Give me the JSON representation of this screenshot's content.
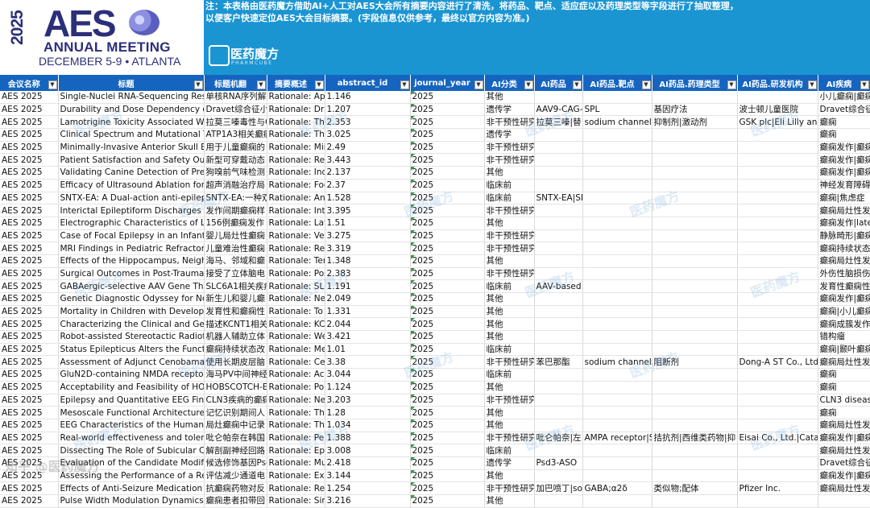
{
  "logo": {
    "year": "2025",
    "word": "AES",
    "subtitle": "ANNUAL MEETING",
    "dates": "DECEMBER 5-9 • ATLANTA"
  },
  "notice": {
    "line1": "注：本表格由医药魔方借助AI+人工对AES大会所有摘要内容进行了清洗，将药品、靶点、适应症以及药理类型等字段进行了抽取整理，",
    "line2": "以便客户快速定位AES大会目标摘要。(字段信息仅供参考，最终以官方内容为准。)"
  },
  "brand": {
    "name": "医药魔方",
    "sub": "PHARMCUBE"
  },
  "watermark": "医药魔方",
  "corner_watermark": "知乎 @医药魔方",
  "columns": [
    "会议名称",
    "标题",
    "标题机翻",
    "摘要概述",
    "abstract_id",
    "journal_year",
    "AI分类",
    "AI药品",
    "AI药品.靶点",
    "AI药品.药理类型",
    "AI药品.研发机构",
    "AI疾病"
  ],
  "rows": [
    [
      "AES 2025",
      "Single-Nuclei RNA-Sequencing Res",
      "单核RNA序列解",
      "Rationale: App",
      "1.146",
      "2025",
      "其他",
      "",
      "",
      "",
      "",
      "小儿癫痫|癫痫"
    ],
    [
      "AES 2025",
      "Durability and Dose Dependency of",
      "Dravet综合征小",
      "Rationale: Dra",
      "1.207",
      "2025",
      "遗传学",
      "AAV9-CAG-",
      "SPL",
      "基因疗法",
      "波士顿儿童医院",
      "Dravet综合征"
    ],
    [
      "AES 2025",
      "Lamotrigine Toxicity Associated Wi",
      "拉莫三嗪毒性与C",
      "Rationale: The",
      "2.353",
      "2025",
      "非干预性研究",
      "拉莫三嗪|替",
      "sodium channel|C",
      "抑制剂|激动剂",
      "GSK plc|Eli Lilly and",
      "癫痫"
    ],
    [
      "AES 2025",
      "Clinical Spectrum and Mutational T",
      "ATP1A3相关癫痫",
      "Rationale: The",
      "3.025",
      "2025",
      "遗传学",
      "",
      "",
      "",
      "",
      "癫痫"
    ],
    [
      "AES 2025",
      "Minimally-Invasive Anterior Skull Ba",
      "用于儿童癫痫的",
      "Rationale: Min",
      "2.49",
      "2025",
      "非干预性研究",
      "",
      "",
      "",
      "",
      "癫痫发作|癫痫"
    ],
    [
      "AES 2025",
      "Patient Satisfaction and Safety Outc",
      "新型可穿戴动态",
      "Rationale: Rem",
      "3.443",
      "2025",
      "非干预性研究",
      "",
      "",
      "",
      "",
      "癫痫发作|癫痫"
    ],
    [
      "AES 2025",
      "Validating  Canine Detection of Pre",
      "狗嗅前气味检测",
      "Rationale: Ind",
      "2.137",
      "2025",
      "其他",
      "",
      "",
      "",
      "",
      "癫痫发作|癫痫"
    ],
    [
      "AES 2025",
      "Efficacy of Ultrasound Ablation for",
      "超声消融治疗局",
      "Rationale: Foc",
      "2.37",
      "2025",
      "临床前",
      "",
      "",
      "",
      "",
      "神经发育障碍"
    ],
    [
      "AES 2025",
      "SNTX-EA: A Dual-action anti-epilep",
      "SNTX-EA:一种双",
      "Rationale: Ant",
      "1.528",
      "2025",
      "临床前",
      "SNTX-EA|SN",
      "",
      "",
      "",
      "癫痫|焦虑症"
    ],
    [
      "AES 2025",
      "Interictal Epileptiform Discharges a",
      "发作间期癫痫样",
      "Rationale: Inte",
      "3.395",
      "2025",
      "非干预性研究",
      "",
      "",
      "",
      "",
      "癫痫局灶性发作"
    ],
    [
      "AES 2025",
      "Electrographic Characteristics of La",
      "156例癫痫发作",
      "Rationale: Late",
      "1.51",
      "2025",
      "其他",
      "",
      "",
      "",
      "",
      "癫痫发作|late"
    ],
    [
      "AES 2025",
      "Case of Focal Epilepsy in an Infant w",
      "婴儿局灶性癫痫",
      "Rationale: Vei",
      "3.275",
      "2025",
      "非干预性研究",
      "",
      "",
      "",
      "",
      "静脉畸形|癫痫"
    ],
    [
      "AES 2025",
      "MRI Findings in Pediatric Refractory",
      "儿童难治性癫痫",
      "Rationale: Rep",
      "3.319",
      "2025",
      "非干预性研究",
      "",
      "",
      "",
      "",
      "癫痫持续状态"
    ],
    [
      "AES 2025",
      "Effects of the Hippocampus, Neighb",
      "海马、邻域和癫",
      "Rationale: Tem",
      "1.348",
      "2025",
      "其他",
      "",
      "",
      "",
      "",
      "癫痫局灶性发作"
    ],
    [
      "AES 2025",
      "Surgical Outcomes in Post-Traumati",
      "接受了立体脑电",
      "Rationale: Pos",
      "2.383",
      "2025",
      "非干预性研究",
      "",
      "",
      "",
      "",
      "外伤性脑损伤"
    ],
    [
      "AES 2025",
      "GABAergic-selective AAV Gene The",
      "SLC6A1相关疾病",
      "Rationale: SLC",
      "1.191",
      "2025",
      "临床前",
      "AAV-based",
      "",
      "",
      "",
      "发育性癫痫性"
    ],
    [
      "AES 2025",
      "Genetic Diagnostic Odyssey for Ne",
      "新生儿和婴儿癫",
      "Rationale: Neo",
      "2.049",
      "2025",
      "其他",
      "",
      "",
      "",
      "",
      "癫痫发作|癫痫"
    ],
    [
      "AES 2025",
      "Mortality in Children with Developm",
      "发育性和癫痫性",
      "Rationale: To",
      "1.331",
      "2025",
      "其他",
      "",
      "",
      "",
      "",
      "癫痫|小儿癫痫"
    ],
    [
      "AES 2025",
      "Characterizing the Clinical and Gene",
      "描述KCNT1相关",
      "Rationale: KCN",
      "2.044",
      "2025",
      "其他",
      "",
      "",
      "",
      "",
      "癫痫成簇发作"
    ],
    [
      "AES 2025",
      "Robot-assisted Stereotactic Radiofr",
      "机器人辅助立体",
      "Rationale: We",
      "3.421",
      "2025",
      "其他",
      "",
      "",
      "",
      "",
      "错构瘤"
    ],
    [
      "AES 2025",
      "Status Epilepticus Alters the Functi",
      "癫痫持续状态改",
      "Rationale: Me",
      "1.01",
      "2025",
      "临床前",
      "",
      "",
      "",
      "",
      "癫痫|颞叶癫痫"
    ],
    [
      "AES 2025",
      "Assessment of Adjunct Cenobamat",
      "使用长期皮层脑",
      "Rationale: Cen",
      "3.38",
      "2025",
      "非干预性研究",
      "苯巴那酯",
      "sodium channel",
      "阻断剂",
      "Dong-A ST Co., Ltd.",
      "癫痫局灶性发作"
    ],
    [
      "AES 2025",
      "GluN2D-containing NMDA receptor",
      "海马PV中间神经",
      "Rationale: Acc",
      "3.044",
      "2025",
      "临床前",
      "",
      "",
      "",
      "",
      "癫痫"
    ],
    [
      "AES 2025",
      "Acceptability and Feasibility of HOB",
      "HOBSCOTCH-ES",
      "Rationale: Pop",
      "1.124",
      "2025",
      "其他",
      "",
      "",
      "",
      "",
      "癫痫"
    ],
    [
      "AES 2025",
      "Epilepsy and Quantitative EEG Findi",
      "CLN3疾病的癫痫",
      "Rationale: Neu",
      "3.203",
      "2025",
      "非干预性研究",
      "",
      "",
      "",
      "",
      "CLN3 disease"
    ],
    [
      "AES 2025",
      "Mesoscale Functional Architecture",
      "记忆识别期间人",
      "Rationale: The",
      "1.28",
      "2025",
      "其他",
      "",
      "",
      "",
      "",
      "癫痫"
    ],
    [
      "AES 2025",
      "EEG Characteristics of the Human C",
      "局灶癫痫中记录",
      "Rationale: The",
      "1.034",
      "2025",
      "其他",
      "",
      "",
      "",
      "",
      "癫痫局灶性发作"
    ],
    [
      "AES 2025",
      "Real-world effectiveness and tolera",
      "吡仑帕奈在韩国",
      "Rationale: Per",
      "1.388",
      "2025",
      "非干预性研究",
      "吡仑帕奈|左",
      "AMPA receptor|S",
      "拮抗剂|西维类药物|抑",
      "Eisai Co., Ltd.|Cataly",
      "癫痫发作|癫痫"
    ],
    [
      "AES 2025",
      "Dissecting The Role of Subicular Cir",
      "解剖副神经回路",
      "Rationale: Epil",
      "3.008",
      "2025",
      "临床前",
      "",
      "",
      "",
      "",
      "癫痫局灶性发作"
    ],
    [
      "AES 2025",
      "Evaluation of the Candidate Modifie",
      "候选修饰基因Psd",
      "Rationale: Mut",
      "2.418",
      "2025",
      "遗传学",
      "Psd3-ASO",
      "",
      "",
      "",
      "Dravet综合征"
    ],
    [
      "AES 2025",
      "Assessing the Performance of a Red",
      "评估减少通道电",
      "Rationale: Ext",
      "3.144",
      "2025",
      "其他",
      "",
      "",
      "",
      "",
      "癫痫发作|癫痫"
    ],
    [
      "AES 2025",
      "Effects of Anti-Seizure Medication o",
      "抗癫痫药物对反",
      "Rationale: Res",
      "1.254",
      "2025",
      "非干预性研究",
      "加巴喷丁|so",
      "GABA;α2δ",
      "类似物;配体",
      "Pfizer Inc.",
      "癫痫局灶性发作"
    ],
    [
      "AES 2025",
      "Pulse Width Modulation Dynamics i",
      "癫痫患者扣带回",
      "Rationale: Sin",
      "3.216",
      "2025",
      "其他",
      "",
      "",
      "",
      "",
      ""
    ]
  ]
}
